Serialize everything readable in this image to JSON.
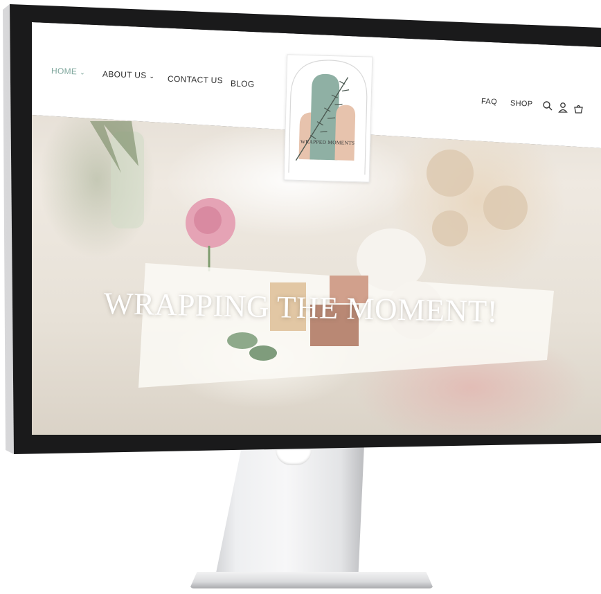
{
  "nav_left": [
    {
      "label": "HOME",
      "active": true,
      "has_dropdown": true
    },
    {
      "label": "ABOUT US",
      "active": false,
      "has_dropdown": true
    },
    {
      "label": "CONTACT US",
      "active": false,
      "has_dropdown": false
    },
    {
      "label": "BLOG",
      "active": false,
      "has_dropdown": false
    }
  ],
  "nav_right": [
    {
      "label": "FAQ"
    },
    {
      "label": "SHOP"
    }
  ],
  "header_icons": [
    "search-icon",
    "account-icon",
    "cart-icon"
  ],
  "logo": {
    "text": "WRAPPED MOMENTS"
  },
  "hero": {
    "title": "WRAPPING THE MOMENT!"
  },
  "colors": {
    "accent": "#7fa79d",
    "arch_green": "#8fb0a4",
    "arch_peach": "#e7c3ad",
    "nav_text": "#2d2d2d",
    "hero_text": "#ffffff"
  }
}
